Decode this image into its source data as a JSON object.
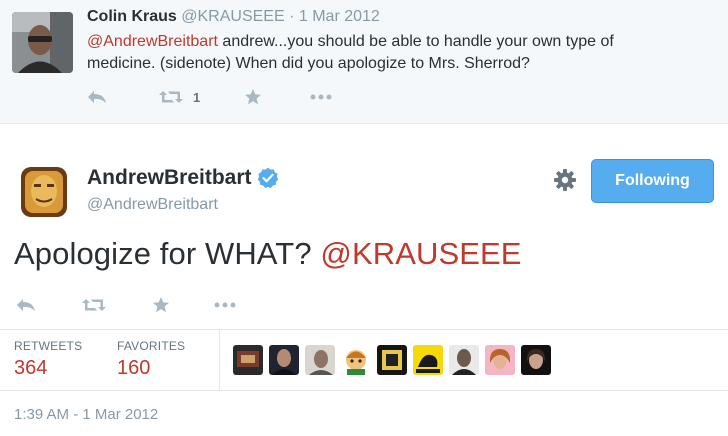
{
  "reply_tweet": {
    "fullname": "Colin Kraus",
    "handle": "@KRAUSEEE",
    "separator": "·",
    "time": "1 Mar 2012",
    "mention": "@AndrewBreitbart",
    "text_line1": " andrew...you should be able to handle your own type of",
    "text_line2": "medicine. (sidenote) When did you apologize to Mrs. Sherrod?",
    "retweet_count": "1",
    "icons": [
      "reply-icon",
      "retweet-icon",
      "favorite-icon",
      "more-icon"
    ]
  },
  "main_tweet": {
    "fullname": "AndrewBreitbart",
    "handle": "@AndrewBreitbart",
    "follow_button": "Following",
    "text": "Apologize for WHAT? ",
    "mention": "@KRAUSEEE",
    "icons": [
      "reply-icon",
      "retweet-icon",
      "favorite-icon",
      "more-icon",
      "gear-icon",
      "verified-badge-icon"
    ],
    "stats": {
      "retweets_label": "RETWEETS",
      "retweets_value": "364",
      "favorites_label": "FAVORITES",
      "favorites_value": "160"
    },
    "favoriter_avatar_count": 9,
    "timestamp": "1:39 AM - 1 Mar 2012"
  },
  "colors": {
    "accent": "#55acee",
    "mention": "#c0392b",
    "muted": "#8899a6",
    "reply_bg": "#f5f8fa",
    "stat_value": "#c0392b"
  }
}
